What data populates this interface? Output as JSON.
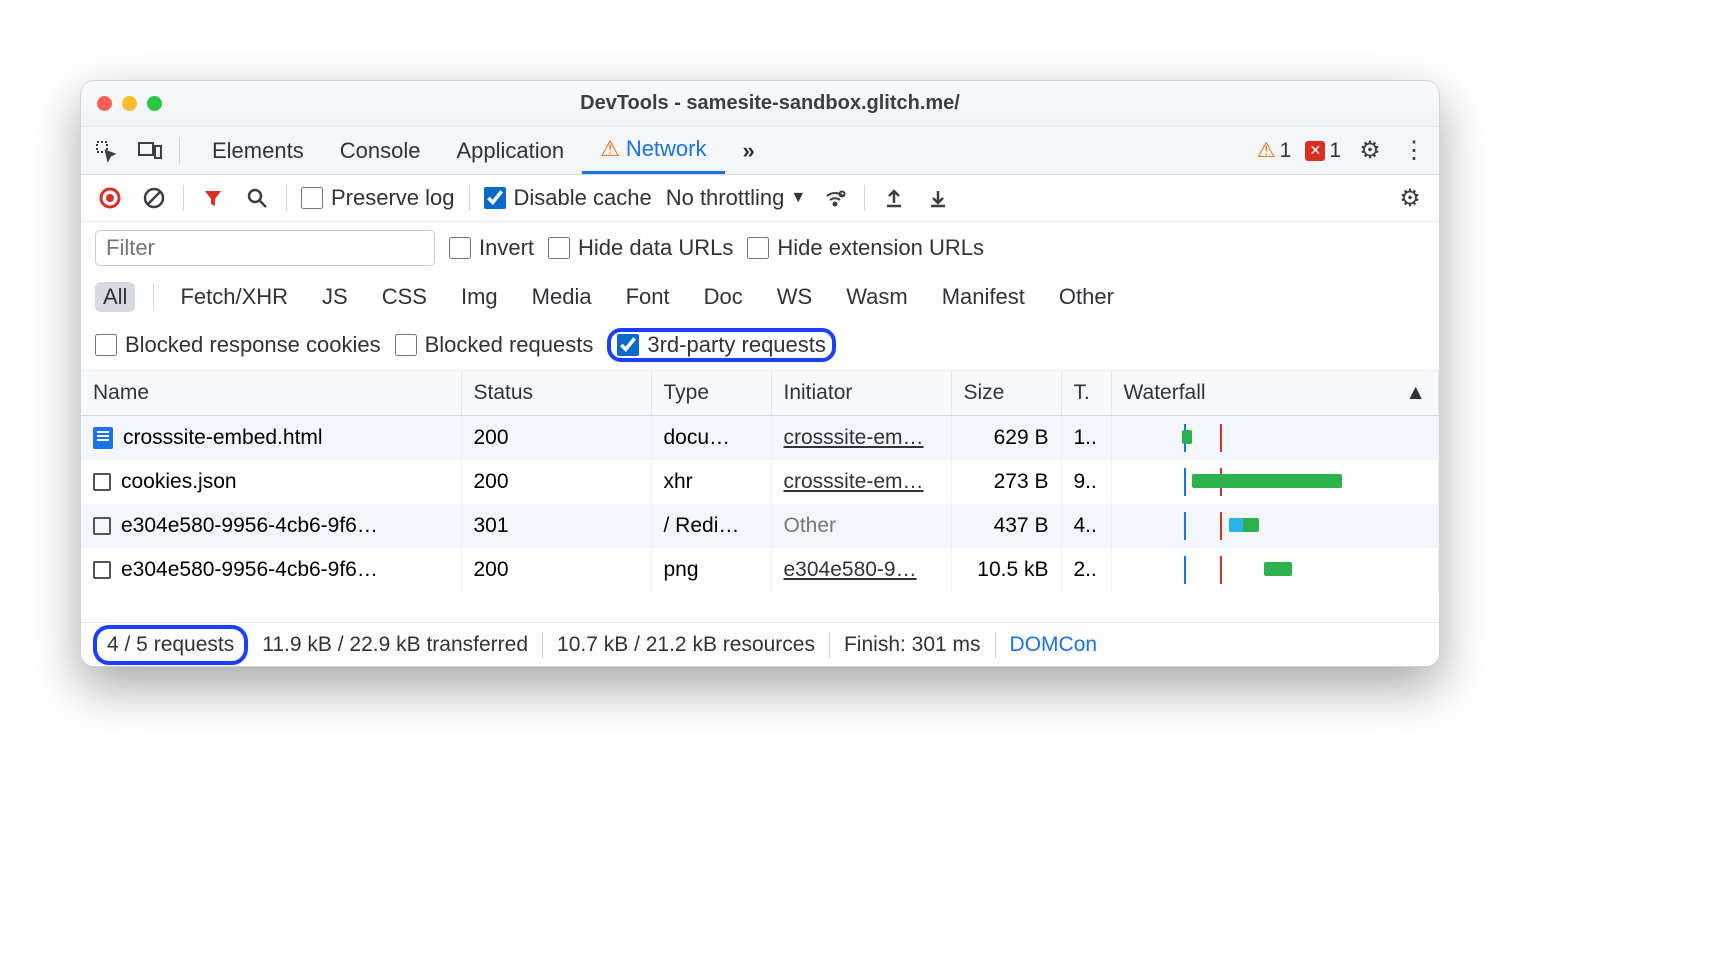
{
  "titlebar": {
    "title": "DevTools - samesite-sandbox.glitch.me/"
  },
  "tabs": {
    "items": [
      "Elements",
      "Console",
      "Application",
      "Network"
    ],
    "active": "Network",
    "warning_count": "1",
    "error_count": "1"
  },
  "toolbar": {
    "preserve_log": "Preserve log",
    "disable_cache": "Disable cache",
    "throttling": "No throttling"
  },
  "filter": {
    "placeholder": "Filter",
    "invert": "Invert",
    "hide_data": "Hide data URLs",
    "hide_ext": "Hide extension URLs",
    "types": [
      "All",
      "Fetch/XHR",
      "JS",
      "CSS",
      "Img",
      "Media",
      "Font",
      "Doc",
      "WS",
      "Wasm",
      "Manifest",
      "Other"
    ],
    "blocked_cookies": "Blocked response cookies",
    "blocked_req": "Blocked requests",
    "third_party": "3rd-party requests"
  },
  "table": {
    "headers": {
      "name": "Name",
      "status": "Status",
      "type": "Type",
      "initiator": "Initiator",
      "size": "Size",
      "time": "T.",
      "waterfall": "Waterfall"
    },
    "rows": [
      {
        "name": "crosssite-embed.html",
        "icon": "doc",
        "status": "200",
        "type": "docu…",
        "initiator": "crosssite-em…",
        "initiator_link": true,
        "size": "629 B",
        "time": "1.."
      },
      {
        "name": "cookies.json",
        "icon": "out",
        "status": "200",
        "type": "xhr",
        "initiator": "crosssite-em…",
        "initiator_link": true,
        "size": "273 B",
        "time": "9.."
      },
      {
        "name": "e304e580-9956-4cb6-9f6…",
        "icon": "out",
        "status": "301",
        "type": "/ Redi…",
        "initiator": "Other",
        "initiator_link": false,
        "size": "437 B",
        "time": "4.."
      },
      {
        "name": "e304e580-9956-4cb6-9f6…",
        "icon": "out",
        "status": "200",
        "type": "png",
        "initiator": "e304e580-9…",
        "initiator_link": true,
        "size": "10.5 kB",
        "time": "2.."
      }
    ]
  },
  "status": {
    "requests": "4 / 5 requests",
    "transferred": "11.9 kB / 22.9 kB transferred",
    "resources": "10.7 kB / 21.2 kB resources",
    "finish": "Finish: 301 ms",
    "domcont": "DOMCon"
  }
}
